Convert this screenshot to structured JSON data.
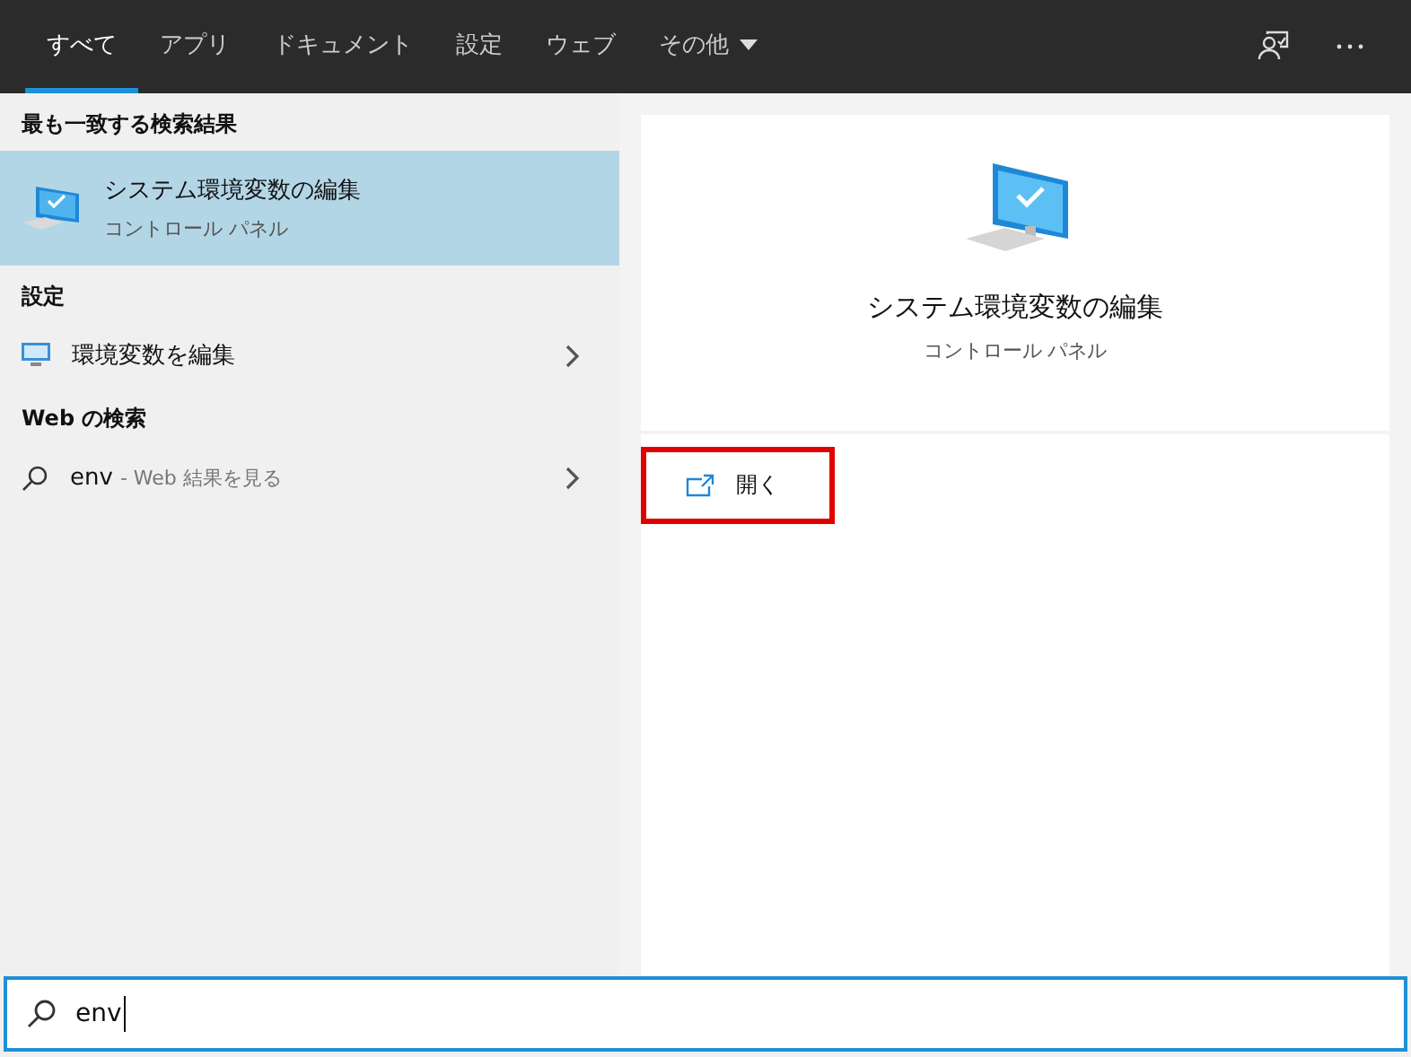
{
  "tabs": [
    {
      "label": "すべて",
      "selected": true
    },
    {
      "label": "アプリ",
      "selected": false
    },
    {
      "label": "ドキュメント",
      "selected": false
    },
    {
      "label": "設定",
      "selected": false
    },
    {
      "label": "ウェブ",
      "selected": false
    },
    {
      "label": "その他",
      "selected": false,
      "dropdown": true
    }
  ],
  "sections": [
    {
      "heading": "最も一致する検索結果",
      "items": [
        {
          "kind": "best",
          "title": "システム環境変数の編集",
          "subtitle": "コントロール パネル",
          "selected": true
        }
      ]
    },
    {
      "heading": "設定",
      "items": [
        {
          "kind": "setting",
          "title": "環境変数を編集",
          "selected": false
        }
      ]
    },
    {
      "heading": "Web の検索",
      "items": [
        {
          "kind": "web",
          "title": "env",
          "suffix": "- Web 結果を見る",
          "selected": false
        }
      ]
    }
  ],
  "detail": {
    "title": "システム環境変数の編集",
    "subtitle": "コントロール パネル",
    "actions": [
      {
        "label": "開く",
        "highlighted": true
      }
    ]
  },
  "search": {
    "value": "env"
  }
}
